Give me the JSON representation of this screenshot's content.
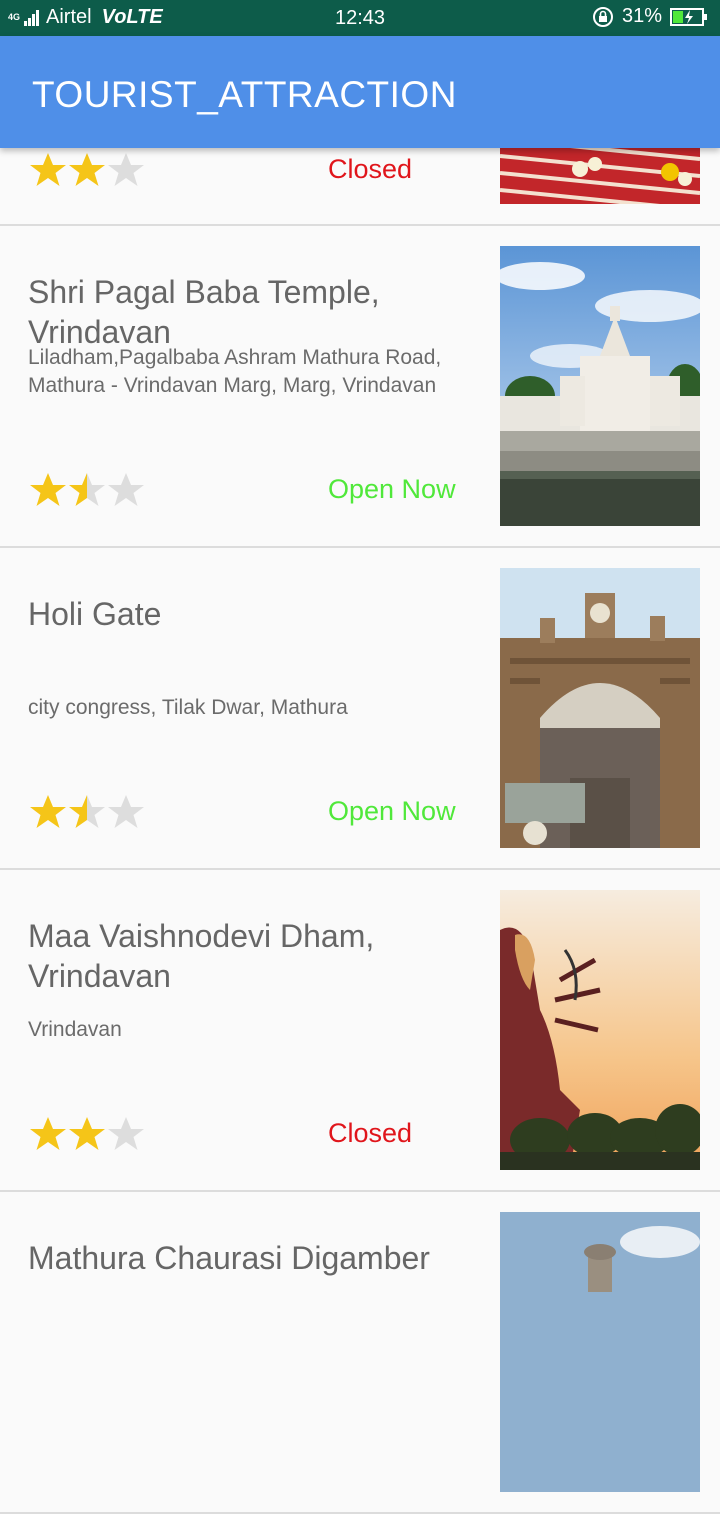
{
  "status_bar": {
    "network": "4G",
    "carrier": "Airtel",
    "volte": "VoLTE",
    "time": "12:43",
    "battery": "31%"
  },
  "app_bar": {
    "title": "TOURIST_ATTRACTION"
  },
  "places": [
    {
      "name": "",
      "address": "",
      "rating": 2,
      "status": "Closed"
    },
    {
      "name": "Shri Pagal Baba Temple, Vrindavan",
      "address": "Liladham,Pagalbaba Ashram Mathura Road, Mathura - Vrindavan Marg, Marg, Vrindavan",
      "rating": 1.5,
      "status": "Open Now"
    },
    {
      "name": "Holi Gate",
      "address": "city congress, Tilak Dwar, Mathura",
      "rating": 1.5,
      "status": "Open Now"
    },
    {
      "name": "Maa Vaishnodevi Dham, Vrindavan",
      "address": "Vrindavan",
      "rating": 2,
      "status": "Closed"
    },
    {
      "name": "Mathura Chaurasi Digamber",
      "address": "",
      "rating": null,
      "status": ""
    }
  ],
  "colors": {
    "app_bar": "#4f8fe8",
    "status_bar": "#0d5c4a",
    "open": "#50e83a",
    "closed": "#e0151b",
    "star_on": "#f5c518",
    "star_off": "#dddddd"
  }
}
